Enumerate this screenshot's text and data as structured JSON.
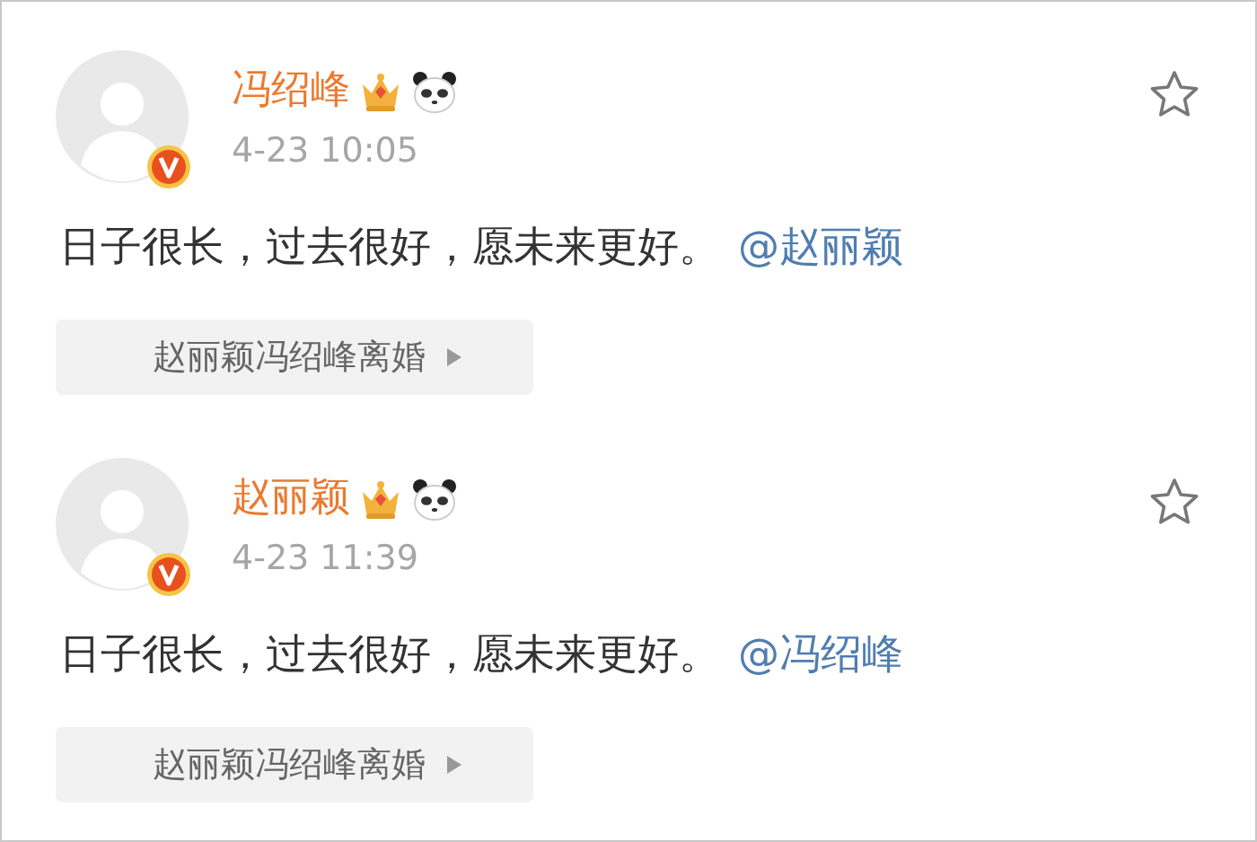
{
  "posts": [
    {
      "author": "冯绍峰",
      "time": "4-23 10:05",
      "text": "日子很长，过去很好，愿未来更好。",
      "mention": "@赵丽颖",
      "topic": "赵丽颖冯绍峰离婚",
      "starred": false
    },
    {
      "author": "赵丽颖",
      "time": "4-23 11:39",
      "text": "日子很长，过去很好，愿未来更好。",
      "mention": "@冯绍峰",
      "topic": "赵丽颖冯绍峰离婚",
      "starred": false
    }
  ]
}
